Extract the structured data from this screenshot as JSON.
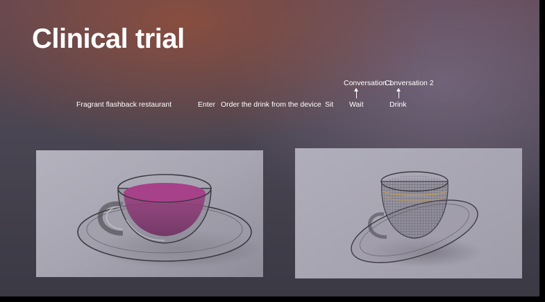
{
  "slide": {
    "title": "Clinical trial",
    "flow": {
      "restaurant": "Fragrant flashback restaurant",
      "enter": "Enter",
      "order": "Order the drink from the device",
      "sit": "Sit",
      "wait": "Wait",
      "drink": "Drink",
      "conversation1": "Conversation 1",
      "conversation2": "Conversation 2"
    }
  },
  "images": [
    {
      "description": "glass-teacup-with-purple-drink-render"
    },
    {
      "description": "wireframe-glass-teacup-render"
    }
  ],
  "colors": {
    "drink": "#8a2f6e",
    "title": "#ffffff"
  }
}
